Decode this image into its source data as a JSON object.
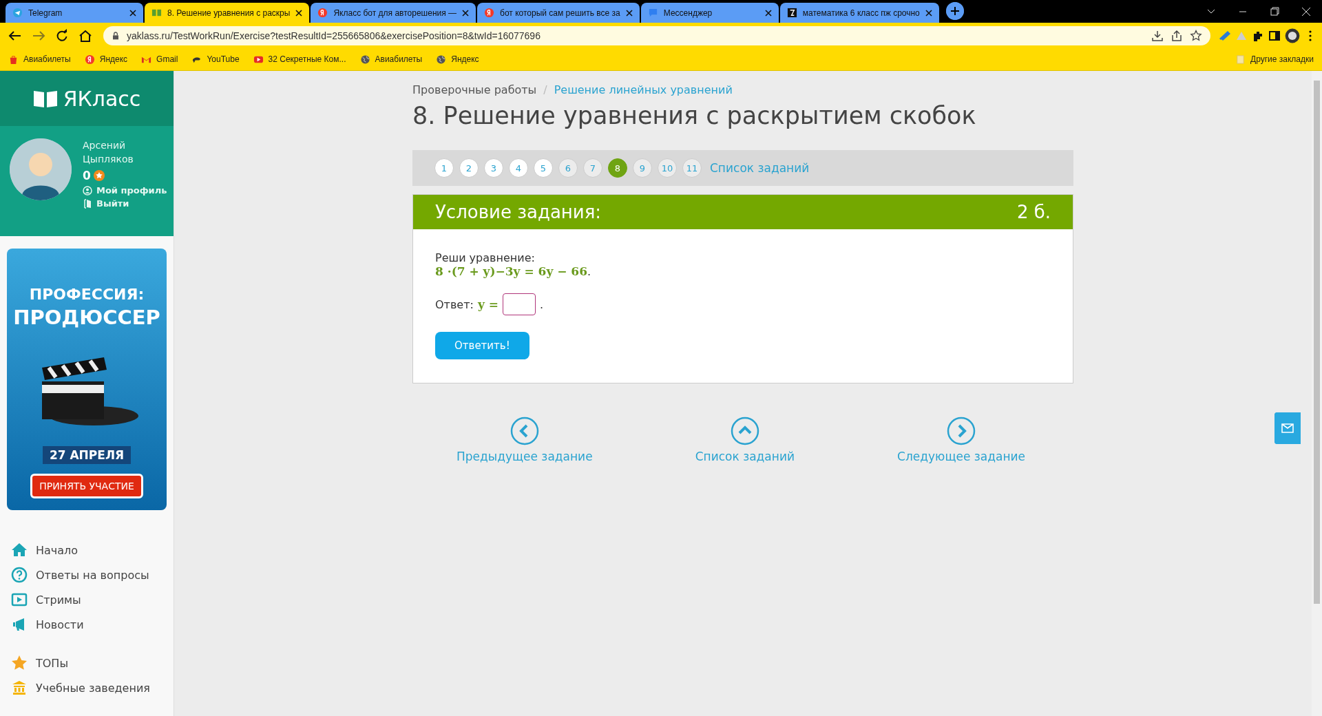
{
  "browser": {
    "tabs": [
      {
        "title": "Telegram",
        "selected": false
      },
      {
        "title": "8. Решение уравнения с раскры",
        "selected": true
      },
      {
        "title": "Якласс бот для авторешения —",
        "selected": false
      },
      {
        "title": "бот который сам решить все за",
        "selected": false
      },
      {
        "title": "Мессенджер",
        "selected": false
      },
      {
        "title": "математика 6 класс пж срочно",
        "selected": false
      }
    ],
    "url": "yaklass.ru/TestWorkRun/Exercise?testResultId=255665806&exercisePosition=8&twId=16077696",
    "bookmarks": [
      {
        "label": "Авиабилеты"
      },
      {
        "label": "Яндекс"
      },
      {
        "label": "Gmail"
      },
      {
        "label": "YouTube"
      },
      {
        "label": "32 Секретные Ком..."
      },
      {
        "label": "Авиабилеты"
      },
      {
        "label": "Яндекс"
      }
    ],
    "other_bookmarks": "Другие закладки"
  },
  "sidebar": {
    "logo": "ЯКласс",
    "user": {
      "name": "Арсений Цыпляков",
      "points": "0",
      "links": [
        {
          "label": "Мой профиль"
        },
        {
          "label": "Выйти"
        }
      ]
    },
    "ad": {
      "line_1": "ПРОФЕССИЯ:",
      "line_2": "ПРОДЮССЕР",
      "date": "27 АПРЕЛЯ",
      "button": "ПРИНЯТЬ УЧАСТИЕ"
    },
    "nav": [
      {
        "label": "Начало"
      },
      {
        "label": "Ответы на вопросы"
      },
      {
        "label": "Стримы"
      },
      {
        "label": "Новости"
      },
      {
        "label": "ТОПы"
      },
      {
        "label": "Учебные заведения"
      }
    ]
  },
  "breadcrumb": {
    "items": [
      {
        "label": "Проверочные работы",
        "link": false
      },
      {
        "label": "Решение линейных уравнений",
        "link": true
      }
    ],
    "separator": "/"
  },
  "title": "8. Решение уравнения с раскрытием скобок",
  "pager": {
    "items": [
      {
        "label": "1",
        "selected": false,
        "visited": true
      },
      {
        "label": "2",
        "selected": false,
        "visited": true
      },
      {
        "label": "3",
        "selected": false,
        "visited": true
      },
      {
        "label": "4",
        "selected": false,
        "visited": true
      },
      {
        "label": "5",
        "selected": false,
        "visited": true
      },
      {
        "label": "6",
        "selected": false,
        "visited": false
      },
      {
        "label": "7",
        "selected": false,
        "visited": false
      },
      {
        "label": "8",
        "selected": true,
        "visited": false
      },
      {
        "label": "9",
        "selected": false,
        "visited": false
      },
      {
        "label": "10",
        "selected": false,
        "visited": false
      },
      {
        "label": "11",
        "selected": false,
        "visited": false
      }
    ],
    "list_link": "Список заданий"
  },
  "task": {
    "header": "Условие задания:",
    "points": "2 б.",
    "prompt": "Реши уравнение:",
    "equation": "8 ·(7 + y)−3y = 6y − 66",
    "equation_end": ".",
    "answer_label": "Ответ:",
    "answer_math": "y =",
    "answer_end": ".",
    "submit": "Ответить!"
  },
  "bottom_nav": [
    {
      "label": "Предыдущее задание"
    },
    {
      "label": "Список заданий"
    },
    {
      "label": "Следующее задание"
    }
  ]
}
